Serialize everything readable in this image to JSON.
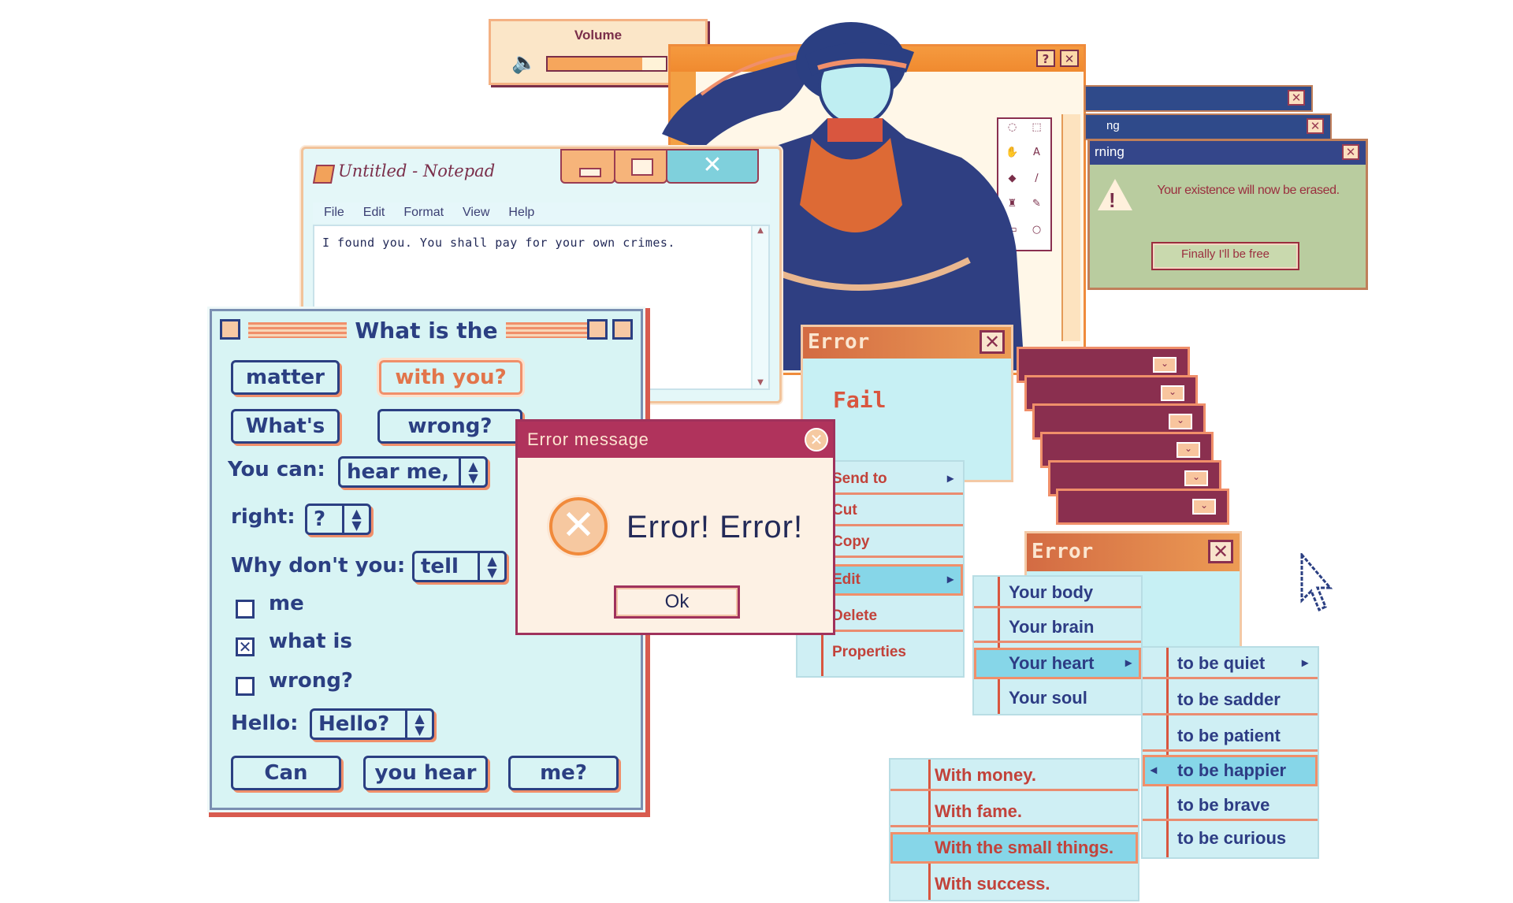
{
  "volume": {
    "title": "Volume",
    "icon": "speaker-icon",
    "level": 0.8
  },
  "paint": {
    "help": "?",
    "close": "✕"
  },
  "warning": {
    "tab2": "ng",
    "title": "rning",
    "message": "Your existence will now be erased.",
    "button": "Finally I'll be free",
    "icon": "warning-icon"
  },
  "notepad": {
    "title": "Untitled - Notepad",
    "menu": [
      "File",
      "Edit",
      "Format",
      "View",
      "Help"
    ],
    "text": "I found you. You shall pay for your own crimes.",
    "close": "✕"
  },
  "what": {
    "title": "What is the",
    "buttons": {
      "matter": "matter",
      "with_you": "with you?",
      "whats": "What's",
      "wrong": "wrong?",
      "can": "Can",
      "you_hear": "you hear",
      "me": "me?"
    },
    "labels": {
      "you_can": "You can:",
      "right": "right:",
      "why": "Why don't you:",
      "hello": "Hello:"
    },
    "selects": {
      "hear_me": "hear me,",
      "right": "?",
      "tell": "tell",
      "hello": "Hello?"
    },
    "checks": [
      {
        "label": "me",
        "checked": false
      },
      {
        "label": "what is",
        "checked": true
      },
      {
        "label": "wrong?",
        "checked": false
      }
    ]
  },
  "error_message": {
    "title": "Error message",
    "text": "Error! Error!",
    "ok": "Ok",
    "close": "✕"
  },
  "error_win1": {
    "title": "Error",
    "body": "Fail",
    "close": "✕"
  },
  "error_win2": {
    "title": "Error",
    "close": "✕"
  },
  "menu1": {
    "items": [
      "Send to",
      "Cut",
      "Copy",
      "Edit",
      "Delete",
      "Properties"
    ]
  },
  "menu2": {
    "items": [
      "Your body",
      "Your brain",
      "Your heart",
      "Your soul"
    ]
  },
  "menu3": {
    "items": [
      "to be quiet",
      "to be sadder",
      "to be patient",
      "to be happier",
      "to be brave",
      "to be curious"
    ]
  },
  "menu4": {
    "items": [
      "With money.",
      "With fame.",
      "With the small things.",
      "With success."
    ]
  },
  "colors": {
    "navy": "#2b3f82",
    "orange": "#f08f6a",
    "cyan": "#c7f0f4",
    "wine": "#8a2f4f"
  }
}
